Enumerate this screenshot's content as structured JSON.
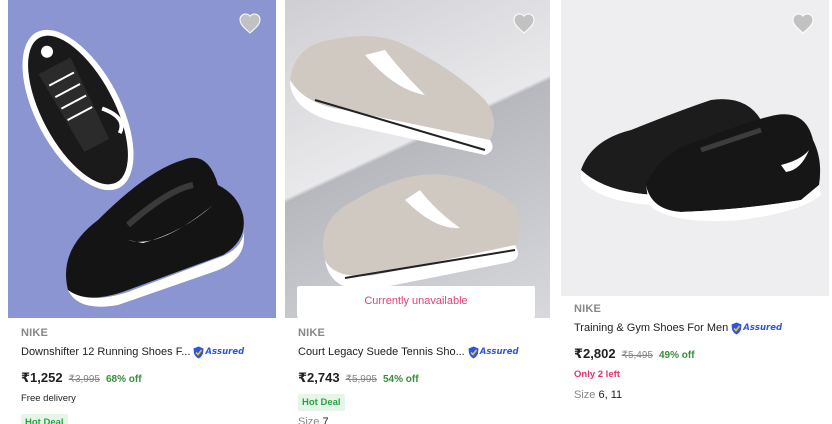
{
  "products": [
    {
      "brand": "NIKE",
      "title": "Downshifter 12 Running Shoes F...",
      "assured_label": "Assured",
      "price": "₹1,252",
      "mrp": "₹3,995",
      "discount": "68% off",
      "delivery": "Free delivery",
      "deal": "Hot Deal",
      "image_background": "#8a95d1"
    },
    {
      "brand": "NIKE",
      "title": "Court Legacy Suede Tennis Sho...",
      "assured_label": "Assured",
      "price": "₹2,743",
      "mrp": "₹5,995",
      "discount": "54% off",
      "availability": "Currently unavailable",
      "deal": "Hot Deal",
      "size_label": "Size",
      "size_value": "7"
    },
    {
      "brand": "NIKE",
      "title": "Training & Gym Shoes For Men",
      "assured_label": "Assured",
      "price": "₹2,802",
      "mrp": "₹5,495",
      "discount": "49% off",
      "stock": "Only 2 left",
      "size_label": "Size",
      "size_value": "6, 11"
    }
  ],
  "colors": {
    "discount_green": "#388e3c",
    "assured_blue": "#2a55e5",
    "alert_pink": "#e0336b",
    "hot_deal_bg": "#e5f6e8"
  },
  "icons": [
    "heart-icon",
    "assured-shield-icon"
  ]
}
